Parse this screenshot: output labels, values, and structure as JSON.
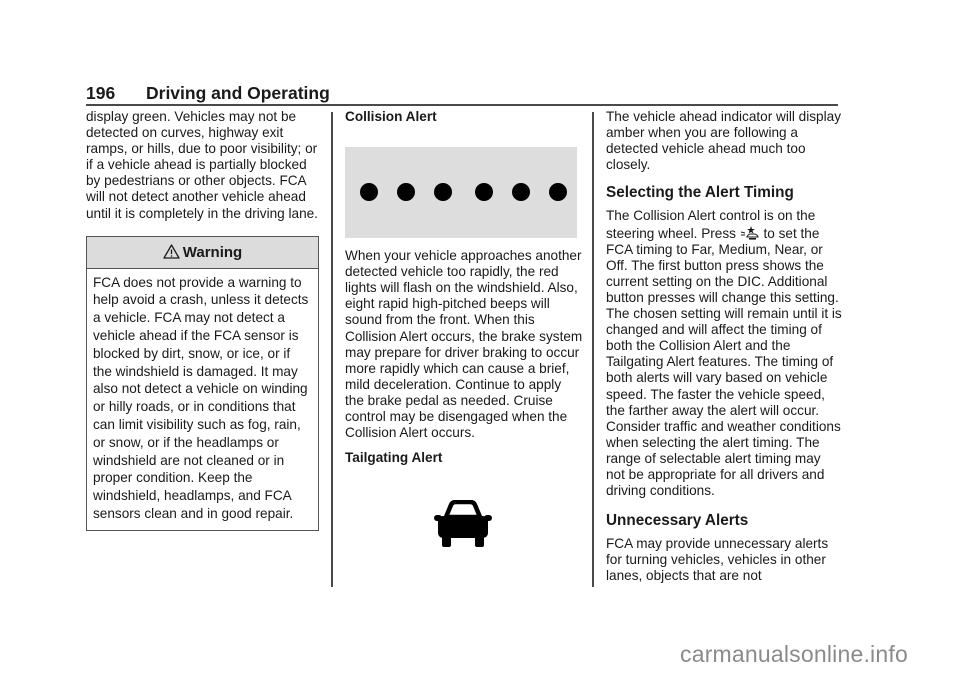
{
  "header": {
    "page_number": "196",
    "section_title": "Driving and Operating"
  },
  "col1": {
    "intro": "display green. Vehicles may not be detected on curves, highway exit ramps, or hills, due to poor visibility; or if a vehicle ahead is partially blocked by pedestrians or other objects. FCA will not detect another vehicle ahead until it is completely in the driving lane.",
    "warning": {
      "icon": "warning-triangle-icon",
      "title": "Warning",
      "body": "FCA does not provide a warning to help avoid a crash, unless it detects a vehicle. FCA may not detect a vehicle ahead if the FCA sensor is blocked by dirt, snow, or ice, or if the windshield is damaged. It may also not detect a vehicle on winding or hilly roads, or in conditions that can limit visibility such as fog, rain, or snow, or if the headlamps or windshield are not cleaned or in proper condition. Keep the windshield, headlamps, and FCA sensors clean and in good repair."
    }
  },
  "col2": {
    "collision_heading": "Collision Alert",
    "collision_figure": {
      "description": "six red lights (shown black) on gray panel",
      "count": 6,
      "panel_color": "#dddddd"
    },
    "collision_text": "When your vehicle approaches another detected vehicle too rapidly, the red lights will flash on the windshield. Also, eight rapid high-pitched beeps will sound from the front. When this Collision Alert occurs, the brake system may prepare for driver braking to occur more rapidly which can cause a brief, mild deceleration. Continue to apply the brake pedal as needed. Cruise control may be disengaged when the Collision Alert occurs.",
    "tailgating_heading": "Tailgating Alert",
    "tailgating_figure": {
      "icon": "vehicle-ahead-icon"
    }
  },
  "col3": {
    "intro": "The vehicle ahead indicator will display amber when you are following a detected vehicle ahead much too closely.",
    "timing_heading": "Selecting the Alert Timing",
    "timing_text_before_icon": "The Collision Alert control is on the steering wheel. Press",
    "timing_icon": "collision-alert-button-icon",
    "timing_text_after_icon": "to set the FCA timing to Far, Medium, Near, or Off. The first button press shows the current setting on the DIC. Additional button presses will change this setting. The chosen setting will remain until it is changed and will affect the timing of both the Collision Alert and the Tailgating Alert features. The timing of both alerts will vary based on vehicle speed. The faster the vehicle speed, the farther away the alert will occur. Consider traffic and weather conditions when selecting the alert timing. The range of selectable alert timing may not be appropriate for all drivers and driving conditions.",
    "unnecessary_heading": "Unnecessary Alerts",
    "unnecessary_text": "FCA may provide unnecessary alerts for turning vehicles, vehicles in other lanes, objects that are not"
  },
  "watermark": "carmanualsonline.info"
}
